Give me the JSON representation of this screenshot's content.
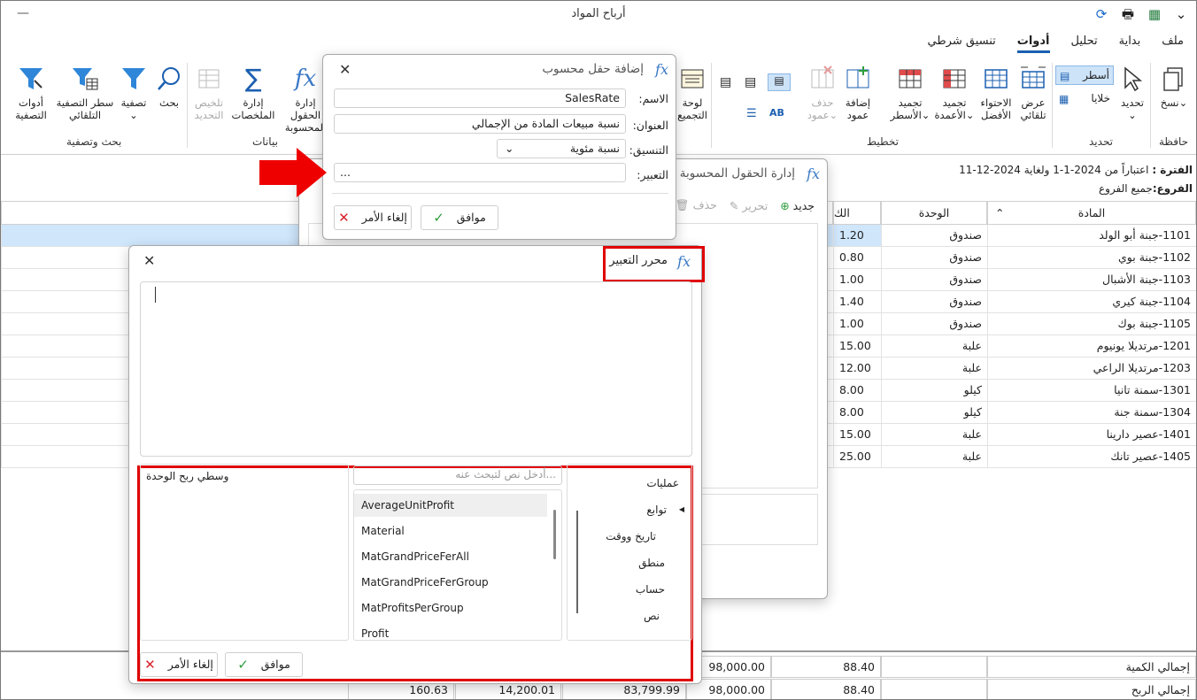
{
  "window": {
    "title": "أرباح المواد",
    "minimize": "—"
  },
  "menu": [
    {
      "label": "ملف"
    },
    {
      "label": "بداية"
    },
    {
      "label": "تحليل"
    },
    {
      "label": "أدوات",
      "active": true
    },
    {
      "label": "تنسيق شرطي"
    }
  ],
  "ribbon": {
    "clipboard": {
      "copy": "نسخ",
      "group": "حافظة"
    },
    "select": {
      "select": "تحديد",
      "rows": "أسطر",
      "cells": "خلايا",
      "group": "تحديد"
    },
    "layout": {
      "autofit": "عرض تلقائي",
      "best_fit": "الاحتواء الأفضل",
      "freeze_cols": "تجميد الأعمدة",
      "freeze_rows": "تجميد الأسطر",
      "add_col": "إضافة عمود",
      "del_col": "حذف عمود",
      "group": "تخطيط"
    },
    "group_panel": "لوحة التجميع",
    "data": {
      "calc_fields": "إدارة الحقول المحسوبة",
      "summaries": "إدارة الملخصات",
      "clear_summary": "تلخيص التحديد",
      "group": "بيانات"
    },
    "filter": {
      "search": "بحث",
      "filter": "تصفية",
      "auto_filter_row": "سطر التصفية التلقائي",
      "filter_tools": "أدوات التصفية",
      "group": "بحث وتصفية"
    }
  },
  "info": {
    "period_label": "الفترة :",
    "period_value": "اعتباراً من 2024-1-1 ولغاية 2024-12-11",
    "branches_label": "الفروع:",
    "branches_value": "جميع الفروع"
  },
  "grid": {
    "headers": {
      "material": "المادة",
      "unit": "الوحدة",
      "qty": "الك"
    },
    "rows": [
      {
        "material": "1101-جبنة أبو الولد",
        "unit": "صندوق",
        "qty": "1.20"
      },
      {
        "material": "1102-جبنة بوي",
        "unit": "صندوق",
        "qty": "0.80"
      },
      {
        "material": "1103-جبنة الأشبال",
        "unit": "صندوق",
        "qty": "1.00"
      },
      {
        "material": "1104-جبنة كيري",
        "unit": "صندوق",
        "qty": "1.40"
      },
      {
        "material": "1105-جبنة بوك",
        "unit": "صندوق",
        "qty": "1.00"
      },
      {
        "material": "1201-مرتديلا يونيوم",
        "unit": "علبة",
        "qty": "15.00"
      },
      {
        "material": "1203-مرتديلا الراعي",
        "unit": "علبة",
        "qty": "12.00"
      },
      {
        "material": "1301-سمنة تانيا",
        "unit": "كيلو",
        "qty": "8.00"
      },
      {
        "material": "1304-سمنة جنة",
        "unit": "كيلو",
        "qty": "8.00"
      },
      {
        "material": "1401-عصير دارينا",
        "unit": "علبة",
        "qty": "15.00"
      },
      {
        "material": "1405-عصير تانك",
        "unit": "علبة",
        "qty": "25.00"
      }
    ],
    "footer": [
      {
        "label": "إجمالي الكمية",
        "qty": "88.40",
        "c1": "98,000.00",
        "c2": "",
        "c3": "",
        "c4": ""
      },
      {
        "label": "إجمالي الربح",
        "qty": "88.40",
        "c1": "98,000.00",
        "c2": "83,799.99",
        "c3": "14,200.01",
        "c4": "160.63"
      }
    ]
  },
  "calc_manager": {
    "title": "إدارة الحقول المحسوبة",
    "new": "جديد",
    "edit": "تحرير",
    "delete": "حذف"
  },
  "add_field": {
    "title": "إضافة حقل محسوب",
    "name_label": "الاسم:",
    "name_value": "SalesRate",
    "caption_label": "العنوان:",
    "caption_value": "نسبة مبيعات المادة من الإجمالي",
    "format_label": "التنسيق:",
    "format_value": "نسبة مئوية",
    "expr_label": "التعبير:",
    "expr_value": "...",
    "ok": "موافق",
    "cancel": "إلغاء الأمر"
  },
  "expr_editor": {
    "title": "محرر التعبير",
    "search_placeholder": "أدخل نص لتبحث عنه...",
    "categories": [
      "عمليات",
      "توابع",
      "تاريخ ووقت",
      "منطق",
      "حساب",
      "نص"
    ],
    "fields": [
      "AverageUnitProfit",
      "Material",
      "MatGrandPriceFerAll",
      "MatGrandPriceFerGroup",
      "MatProfitsPerGroup",
      "Profit"
    ],
    "description": "وسطي ربح الوحدة",
    "ok": "موافق",
    "cancel": "إلغاء الأمر"
  }
}
